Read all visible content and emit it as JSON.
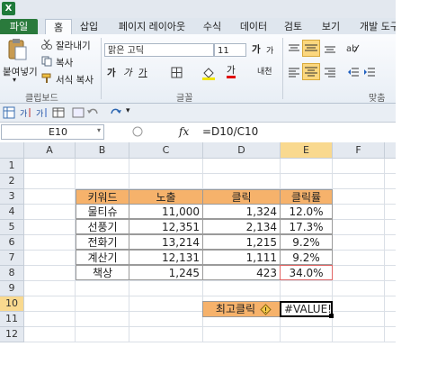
{
  "app": {
    "logo": "X"
  },
  "tabs": [
    "파일",
    "홈",
    "삽입",
    "페이지 레이아웃",
    "수식",
    "데이터",
    "검토",
    "보기",
    "개발 도구"
  ],
  "ribbon": {
    "clipboard": {
      "paste": "붙여넣기",
      "cut": "잘라내기",
      "copy": "복사",
      "format_painter": "서식 복사",
      "group": "클립보드"
    },
    "font": {
      "name": "맑은 고딕",
      "size": "11",
      "bold": "가",
      "italic": "가",
      "underline": "가",
      "group": "글꼴",
      "grow": "가",
      "shrink": "가",
      "font_color": "가",
      "phonetic": "내천"
    },
    "alignment": {
      "group": "맞춤"
    }
  },
  "formula_bar": {
    "name_box": "E10",
    "fx": "fx",
    "formula": "=D10/C10"
  },
  "columns": [
    "A",
    "B",
    "C",
    "D",
    "E",
    "F"
  ],
  "rows": [
    "1",
    "2",
    "3",
    "4",
    "5",
    "6",
    "7",
    "8",
    "9",
    "10",
    "11",
    "12"
  ],
  "table": {
    "headers": [
      "키워드",
      "노출",
      "클릭",
      "클릭률"
    ],
    "rows": [
      [
        "물티슈",
        "11,000",
        "1,324",
        "12.0%"
      ],
      [
        "선풍기",
        "12,351",
        "2,134",
        "17.3%"
      ],
      [
        "전화기",
        "13,214",
        "1,215",
        "9.2%"
      ],
      [
        "계산기",
        "12,131",
        "1,111",
        "9.2%"
      ],
      [
        "책상",
        "1,245",
        "423",
        "34.0%"
      ]
    ]
  },
  "summary": {
    "label": "최고클릭",
    "value": "#VALUE!"
  },
  "colors": {
    "header_fill": "#f6b26b",
    "highlight_border": "#e06666",
    "excel_green": "#2a7a3c"
  }
}
